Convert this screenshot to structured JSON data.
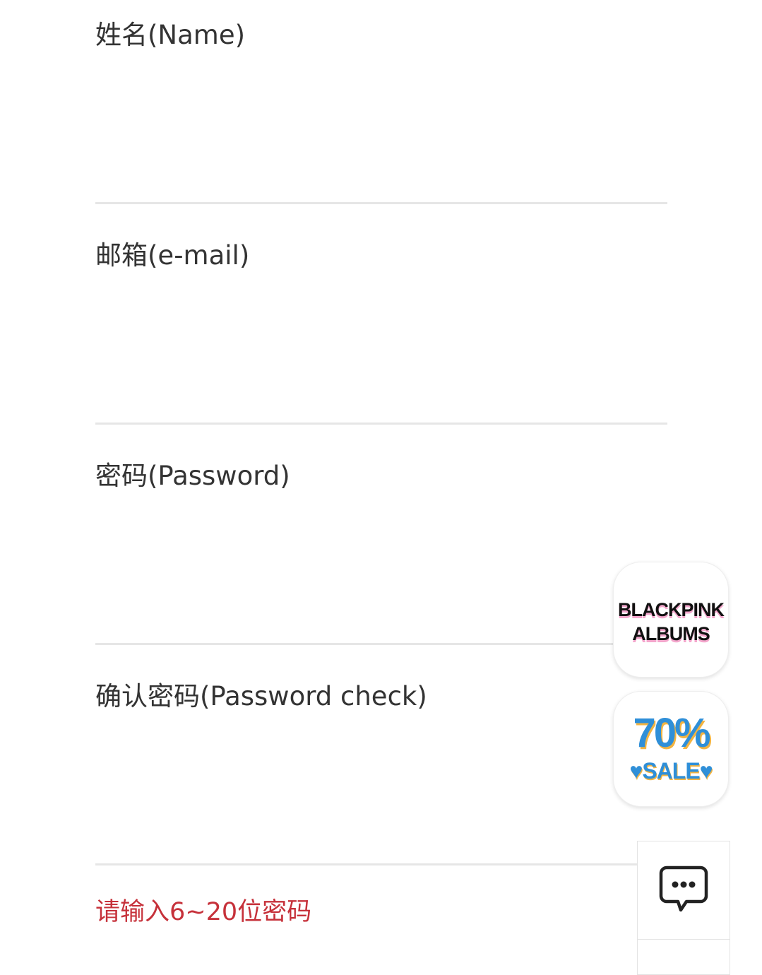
{
  "form": {
    "fields": [
      {
        "label": "姓名(Name)",
        "value": ""
      },
      {
        "label": "邮箱(e-mail)",
        "value": ""
      },
      {
        "label": "密码(Password)",
        "value": ""
      },
      {
        "label": "确认密码(Password check)",
        "value": ""
      }
    ],
    "error_message": "请输入6~20位密码"
  },
  "floating": {
    "albums_badge": {
      "line1": "BLACKPINK",
      "line2": "ALBUMS"
    },
    "sale_badge": {
      "percent": "70%",
      "word": "♥SALE♥"
    },
    "chat_icon": "chat-bubble-icon"
  },
  "colors": {
    "error": "#c6313a",
    "divider": "#e6e6e6",
    "sale_blue": "#2f8fd8",
    "sale_gold": "#f3b441",
    "albums_pink": "#f4a6cc"
  }
}
